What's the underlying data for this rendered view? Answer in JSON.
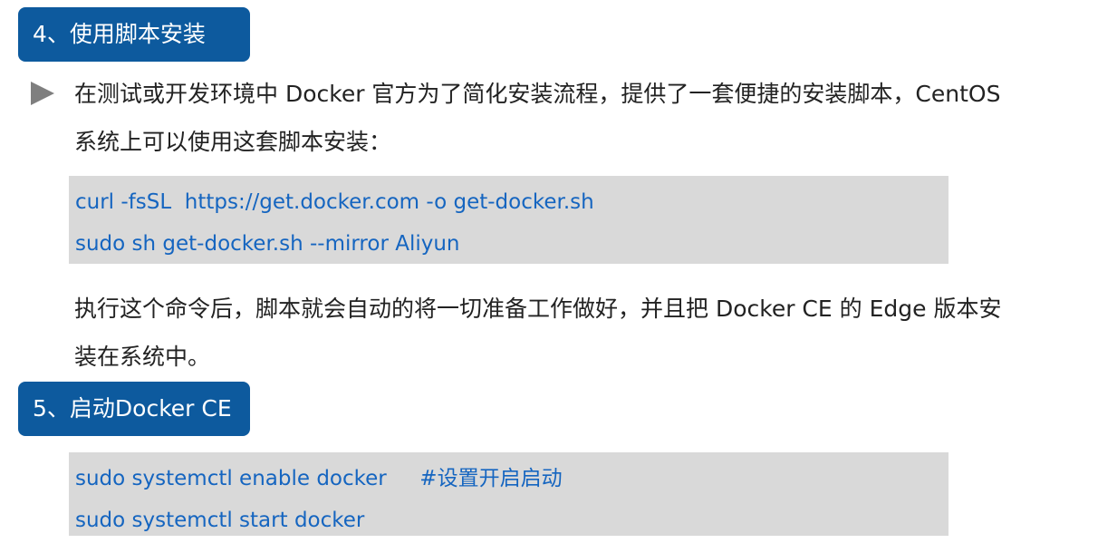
{
  "section4": {
    "title": "4、使用脚本安装"
  },
  "intro": {
    "line1": "在测试或开发环境中 Docker 官方为了简化安装流程，提供了一套便捷的安装脚本，CentOS",
    "line2": "系统上可以使用这套脚本安装："
  },
  "code_block_1": {
    "lines": [
      "curl -fsSL  https://get.docker.com -o get-docker.sh",
      "sudo sh get-docker.sh --mirror Aliyun"
    ]
  },
  "explanation": {
    "line1": "执行这个命令后，脚本就会自动的将一切准备工作做好，并且把 Docker CE 的 Edge 版本安",
    "line2": "装在系统中。"
  },
  "section5": {
    "title": "5、启动Docker CE"
  },
  "code_block_2": {
    "lines": [
      "sudo systemctl enable docker     #设置开启启动",
      "sudo systemctl start docker"
    ]
  },
  "colors": {
    "badge_bg": "#0d5a9e",
    "code_bg": "#d9d9d9",
    "code_text": "#1565c0",
    "bullet": "#7f7f7f"
  },
  "icons": {
    "bullet": "triangle-right-icon"
  }
}
